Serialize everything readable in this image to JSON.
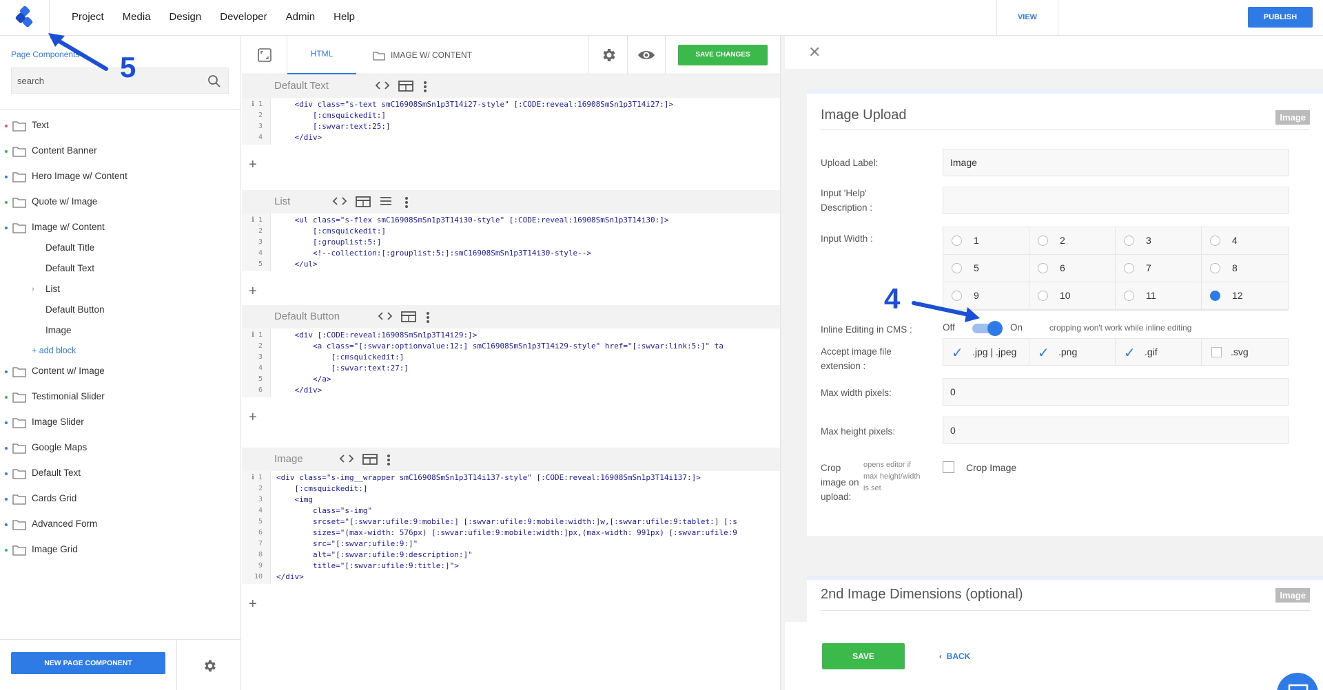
{
  "menu": [
    "Project",
    "Media",
    "Design",
    "Developer",
    "Admin",
    "Help"
  ],
  "top_right": {
    "view": "VIEW",
    "publish": "PUBLISH"
  },
  "sidebar": {
    "title": "Page Components",
    "search_placeholder": "search",
    "items": [
      {
        "label": "Text",
        "dot": "#e55353"
      },
      {
        "label": "Content Banner",
        "dot": "#3cb94b"
      },
      {
        "label": "Hero Image w/ Content",
        "dot": "#2f7be6"
      },
      {
        "label": "Quote w/ Image",
        "dot": "#3cb94b"
      },
      {
        "label": "Image w/ Content",
        "dot": "#2f7be6"
      }
    ],
    "children": [
      "Default Title",
      "Default Text",
      "List",
      "Default Button",
      "Image"
    ],
    "add_block": "+ add block",
    "items_after": [
      {
        "label": "Content w/ Image",
        "dot": "#2f7be6"
      },
      {
        "label": "Testimonial Slider",
        "dot": "#3cb94b"
      },
      {
        "label": "Image Slider",
        "dot": "#2f7be6"
      },
      {
        "label": "Google Maps",
        "dot": "#2f7be6"
      },
      {
        "label": "Default Text",
        "dot": "#2f7be6"
      },
      {
        "label": "Cards Grid",
        "dot": "#2f7be6"
      },
      {
        "label": "Advanced Form",
        "dot": "#2f7be6"
      },
      {
        "label": "Image Grid",
        "dot": "#3cb94b"
      }
    ],
    "new_button": "NEW PAGE COMPONENT"
  },
  "editor": {
    "tab_html": "HTML",
    "tab_component": "IMAGE W/ CONTENT",
    "save_changes": "SAVE CHANGES",
    "blocks": [
      {
        "name": "Default Text",
        "lines": [
          "    <div class=\"s-text smC16908SmSn1p3T14i27-style\" [:CODE:reveal:16908SmSn1p3T14i27:]>",
          "        [:cmsquickedit:]",
          "        [:swvar:text:25:]",
          "    </div>"
        ]
      },
      {
        "name": "List",
        "lines": [
          "    <ul class=\"s-flex smC16908SmSn1p3T14i30-style\" [:CODE:reveal:16908SmSn1p3T14i30:]>",
          "        [:cmsquickedit:]",
          "        [:grouplist:5:]",
          "        <!--collection:[:grouplist:5:]:smC16908SmSn1p3T14i30-style-->",
          "    </ul>"
        ]
      },
      {
        "name": "Default Button",
        "lines": [
          "    <div [:CODE:reveal:16908SmSn1p3T14i29:]>",
          "        <a class=\"[:swvar:optionvalue:12:] smC16908SmSn1p3T14i29-style\" href=\"[:swvar:link:5:]\" ta",
          "            [:cmsquickedit:]",
          "            [:swvar:text:27:]",
          "        </a>",
          "    </div>"
        ]
      },
      {
        "name": "Image",
        "lines": [
          "<div class=\"s-img__wrapper smC16908SmSn1p3T14i137-style\" [:CODE:reveal:16908SmSn1p3T14i137:]>",
          "    [:cmsquickedit:]",
          "    <img",
          "        class=\"s-img\"",
          "        srcset=\"[:swvar:ufile:9:mobile:] [:swvar:ufile:9:mobile:width:]w,[:swvar:ufile:9:tablet:] [:s",
          "        sizes=\"(max-width: 576px) [:swvar:ufile:9:mobile:width:]px,(max-width: 991px) [:swvar:ufile:9",
          "        src=\"[:swvar:ufile:9:]\"",
          "        alt=\"[:swvar:ufile:9:description:]\"",
          "        title=\"[:swvar:ufile:9:title:]\">",
          "</div>"
        ]
      }
    ]
  },
  "panel": {
    "card1_title": "Image Upload",
    "badge": "Image",
    "upload_label": "Upload Label:",
    "upload_value": "Image",
    "help_label": "Input 'Help' Description :",
    "width_label": "Input Width :",
    "width_options": [
      "1",
      "2",
      "3",
      "4",
      "5",
      "6",
      "7",
      "8",
      "9",
      "10",
      "11",
      "12"
    ],
    "width_selected": "12",
    "inline_label": "Inline Editing in CMS :",
    "off": "Off",
    "on": "On",
    "inline_note": "cropping won't work while inline editing",
    "ext_label": "Accept image file extension :",
    "extensions": [
      {
        "label": ".jpg | .jpeg",
        "checked": true
      },
      {
        "label": ".png",
        "checked": true
      },
      {
        "label": ".gif",
        "checked": true
      },
      {
        "label": ".svg",
        "checked": false
      }
    ],
    "max_width_label": "Max width pixels:",
    "max_width_value": "0",
    "max_height_label": "Max height pixels:",
    "max_height_value": "0",
    "crop_label": "Crop image on upload:",
    "crop_help": "opens editor if max height/width is set",
    "crop_text": "Crop Image",
    "card2_title_bold": "2nd",
    "card2_title_rest": " Image Dimensions (optional)",
    "save": "SAVE",
    "back": "BACK"
  },
  "annotations": {
    "a4": "4",
    "a5": "5"
  }
}
